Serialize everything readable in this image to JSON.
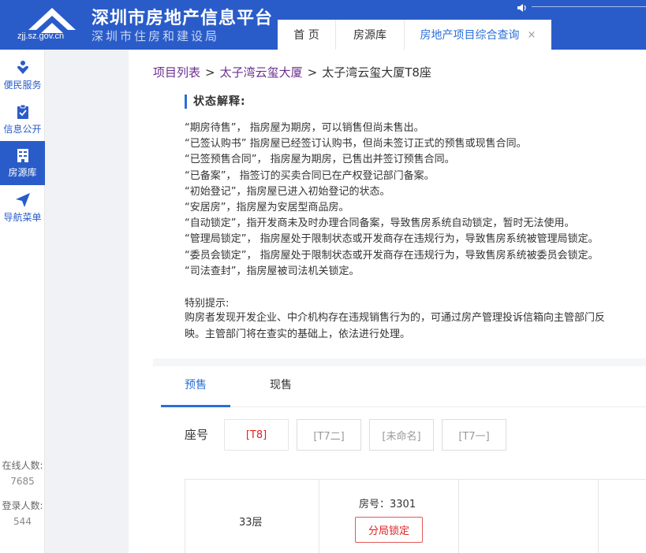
{
  "header": {
    "title": "深圳市房地产信息平台",
    "subtitle": "深圳市住房和建设局",
    "domain": "zjj.sz.gov.cn",
    "colors": {
      "brand": "#2a5cc9",
      "accent": "#2a6fdb"
    }
  },
  "tabs": [
    {
      "label": "首 页"
    },
    {
      "label": "房源库"
    },
    {
      "label": "房地产项目综合查询",
      "close": "×"
    }
  ],
  "sidebar": {
    "items": [
      {
        "label": "便民服务",
        "icon": "heart-person-icon"
      },
      {
        "label": "信息公开",
        "icon": "clipboard-check-icon"
      },
      {
        "label": "房源库",
        "icon": "building-icon"
      },
      {
        "label": "导航菜单",
        "icon": "paper-plane-icon"
      }
    ],
    "online_label": "在线人数:",
    "online_count": "7685",
    "login_label": "登录人数:",
    "login_count": "544"
  },
  "breadcrumb": {
    "item1": "项目列表",
    "item2": "太子湾云玺大厦",
    "current": "太子湾云玺大厦T8座",
    "sep": ">"
  },
  "status": {
    "heading": "状态解释:",
    "lines": [
      "“期房待售”， 指房屋为期房，可以销售但尚未售出。",
      "“已签认购书” 指房屋已经签订认购书，但尚未签订正式的预售或现售合同。",
      "“已签预售合同”， 指房屋为期房，已售出并签订预售合同。",
      "“已备案”， 指签订的买卖合同已在产权登记部门备案。",
      "“初始登记”，指房屋已进入初始登记的状态。",
      "“安居房”，指房屋为安居型商品房。",
      "“自动锁定”，指开发商未及时办理合同备案，导致售房系统自动锁定，暂时无法使用。",
      "“管理局锁定”， 指房屋处于限制状态或开发商存在违规行为，导致售房系统被管理局锁定。",
      "“委员会锁定”， 指房屋处于限制状态或开发商存在违规行为，导致售房系统被委员会锁定。",
      "“司法查封”，指房屋被司法机关锁定。"
    ]
  },
  "tip": {
    "title": "特别提示:",
    "body": "购房者发现开发企业、中介机构存在违规销售行为的，可通过房产管理投诉信箱向主管部门反映。主管部门将在查实的基础上，依法进行处理。"
  },
  "sale_tabs": [
    "预售",
    "现售"
  ],
  "seat": {
    "label": "座号",
    "buttons": [
      "[T8]",
      "[T7二]",
      "[未命名]",
      "[T7一]"
    ]
  },
  "table": {
    "floor": "33层",
    "room": "房号：3301",
    "status": "分局锁定"
  }
}
